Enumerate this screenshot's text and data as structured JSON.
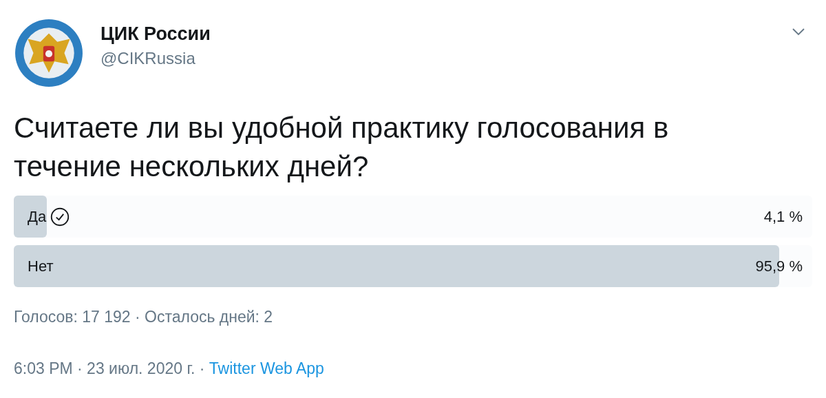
{
  "author": {
    "name": "ЦИК России",
    "handle": "@CIKRussia"
  },
  "question": "Считаете ли вы удобной практику голосования в течение нескольких дней?",
  "options": [
    {
      "label": "Да",
      "selected": true,
      "level": 0.041,
      "percent": "4,1 %"
    },
    {
      "label": "Нет",
      "selected": false,
      "level": 0.959,
      "percent": "95,9 %"
    }
  ],
  "poll_summary": "Голосов: 17 192 · Осталось дней: 2",
  "meta": {
    "time": "6:03 PM · 23 июл. 2020 г. · ",
    "source": "Twitter Web App"
  }
}
